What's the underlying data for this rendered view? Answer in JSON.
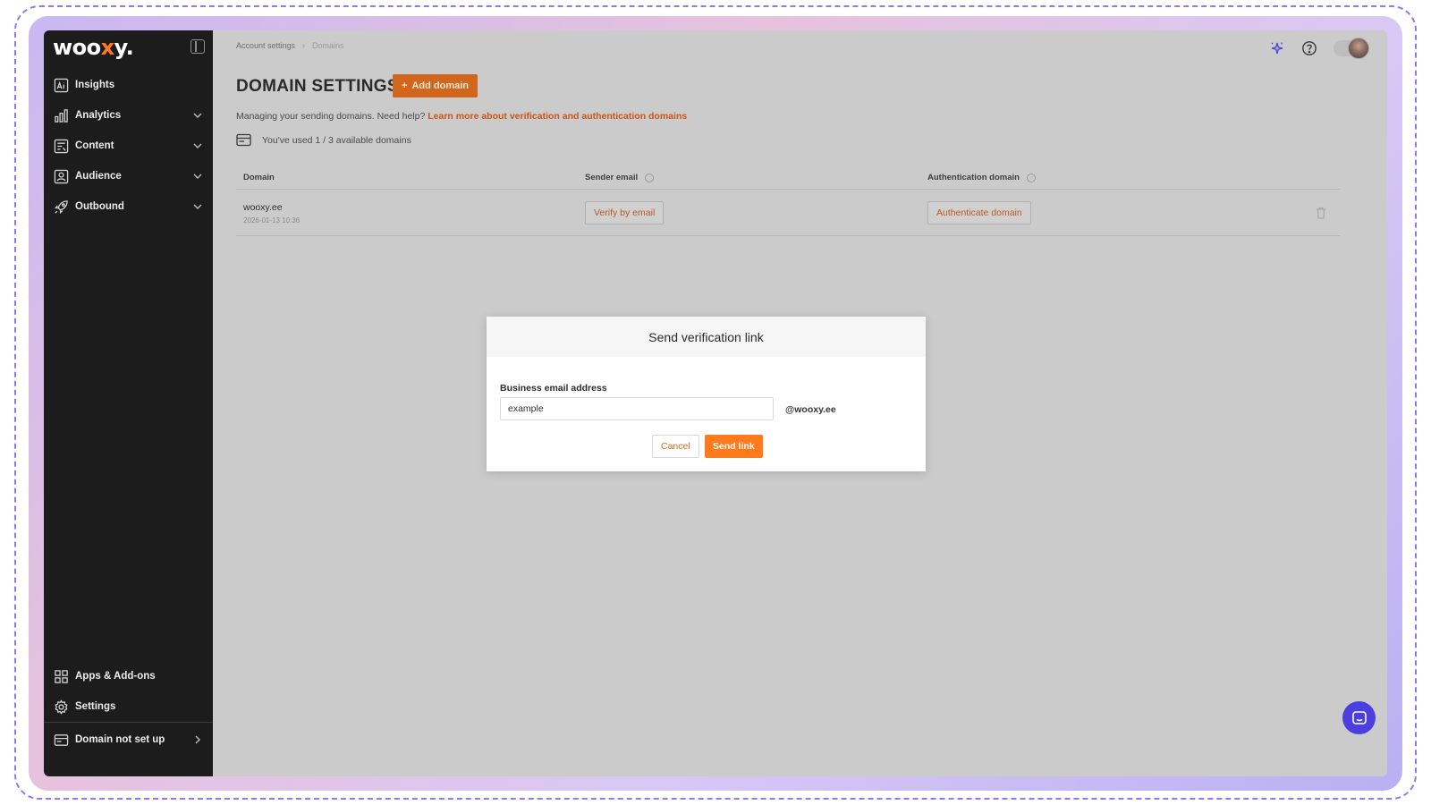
{
  "brand": {
    "logo_pre": "woo",
    "logo_x": "x",
    "logo_post": "y.",
    "accent": "#ff7a1a"
  },
  "sidebar": {
    "items": [
      {
        "label": "Insights",
        "icon": "insights-icon"
      },
      {
        "label": "Analytics",
        "icon": "bar-chart-icon",
        "expandable": true
      },
      {
        "label": "Content",
        "icon": "content-icon",
        "expandable": true
      },
      {
        "label": "Audience",
        "icon": "audience-icon",
        "expandable": true
      },
      {
        "label": "Outbound",
        "icon": "rocket-icon",
        "expandable": true
      }
    ],
    "bottom": [
      {
        "label": "Apps & Add-ons",
        "icon": "grid-icon"
      },
      {
        "label": "Settings",
        "icon": "gear-icon"
      }
    ],
    "domain_status": "Domain not set up"
  },
  "breadcrumb": {
    "parent": "Account settings",
    "current": "Domains"
  },
  "page": {
    "title": "DOMAIN SETTINGS",
    "add_button": "Add domain",
    "help_text": "Managing your sending domains. Need help?",
    "help_link": "Learn more about verification and authentication domains",
    "usage": "You've used 1 / 3 available domains"
  },
  "table": {
    "headers": {
      "domain": "Domain",
      "sender": "Sender email",
      "auth": "Authentication domain"
    },
    "rows": [
      {
        "domain": "wooxy.ee",
        "date": "2026-01-13 10:36",
        "sender_action": "Verify by email",
        "auth_action": "Authenticate domain"
      }
    ]
  },
  "modal": {
    "title": "Send verification link",
    "field_label": "Business email address",
    "field_value": "example",
    "suffix": "@wooxy.ee",
    "cancel": "Cancel",
    "send": "Send link"
  }
}
